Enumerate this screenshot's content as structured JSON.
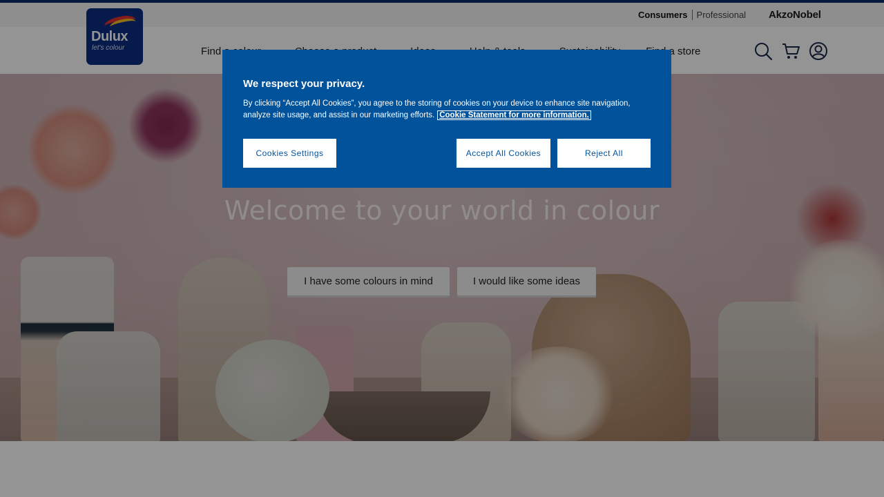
{
  "header": {
    "logo": {
      "brand": "Dulux",
      "tagline": "let's colour"
    },
    "utility": {
      "consumers": "Consumers",
      "professional": "Professional",
      "corporate_logo": "AkzoNobel"
    },
    "nav": [
      {
        "label": "Find a colour",
        "dropdown": true
      },
      {
        "label": "Choose a product",
        "dropdown": true
      },
      {
        "label": "Ideas",
        "dropdown": true
      },
      {
        "label": "Help & tools",
        "dropdown": true
      },
      {
        "label": "Sustainability",
        "dropdown": false
      },
      {
        "label": "Find a store",
        "dropdown": false
      }
    ],
    "icons": [
      "search-icon",
      "cart-icon",
      "account-icon"
    ]
  },
  "hero": {
    "title": "Welcome to your world in colour",
    "buttons": {
      "colours": "I have some colours in mind",
      "ideas": "I would like some ideas"
    }
  },
  "cookie_banner": {
    "title": "We respect your privacy.",
    "body": "By clicking “Accept All Cookies”, you agree to the storing of cookies on your device to enhance site navigation, analyze site usage, and assist in our marketing efforts.",
    "link": "Cookie Statement for more information.",
    "settings_button": "Cookies Settings",
    "accept_button": "Accept All Cookies",
    "reject_button": "Reject All"
  },
  "colors": {
    "brand_navy": "#0c2d83",
    "cookie_blue": "#00529b",
    "top_border": "#0b2a6a"
  }
}
